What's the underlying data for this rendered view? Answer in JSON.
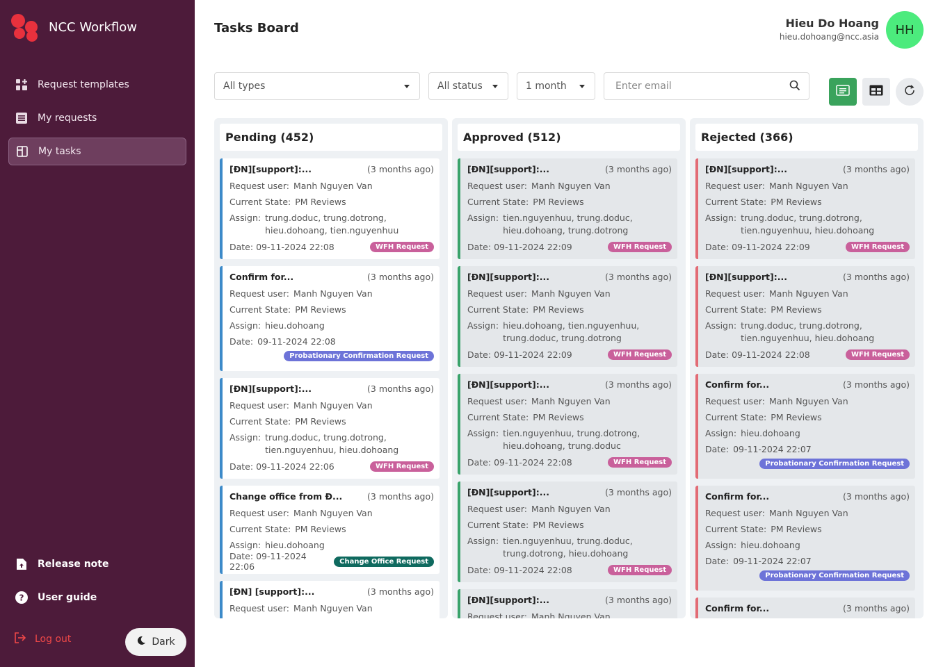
{
  "app": {
    "name": "NCC Workflow"
  },
  "sidebar": {
    "items": [
      {
        "label": "Request templates",
        "icon": "dashboard-add-icon"
      },
      {
        "label": "My requests",
        "icon": "list-icon"
      },
      {
        "label": "My tasks",
        "icon": "board-icon",
        "active": true
      }
    ],
    "bottom": [
      {
        "label": "Release note",
        "icon": "file-upload-icon"
      },
      {
        "label": "User guide",
        "icon": "help-circle-icon"
      }
    ],
    "logout": "Log out",
    "dark": "Dark"
  },
  "header": {
    "title": "Tasks Board",
    "user_name": "Hieu Do Hoang",
    "user_email": "hieu.dohoang@ncc.asia",
    "avatar": "HH"
  },
  "filters": {
    "type": "All types",
    "status": "All status",
    "period": "1 month",
    "email_placeholder": "Enter email"
  },
  "labels": {
    "request_user": "Request user:",
    "state": "Current State:",
    "assign": "Assign:",
    "date": "Date:"
  },
  "columns": [
    {
      "title": "Pending (452)",
      "cards": [
        {
          "title": "[ĐN][support]:...",
          "ago": "(3 months ago)",
          "user": "Manh Nguyen Van",
          "state": "PM Reviews",
          "assign": "trung.doduc, trung.dotrong, hieu.dohoang, tien.nguyenhuu",
          "date": "09-11-2024 22:08",
          "badge": "WFH Request"
        },
        {
          "title": "Confirm for...",
          "ago": "(3 months ago)",
          "user": "Manh Nguyen Van",
          "state": "PM Reviews",
          "assign": "hieu.dohoang",
          "date": "09-11-2024 22:08",
          "badge": "Probationary Confirmation Request"
        },
        {
          "title": "[ĐN][support]:...",
          "ago": "(3 months ago)",
          "user": "Manh Nguyen Van",
          "state": "PM Reviews",
          "assign": "trung.doduc, trung.dotrong, tien.nguyenhuu, hieu.dohoang",
          "date": "09-11-2024 22:06",
          "badge": "WFH Request"
        },
        {
          "title": "Change office from Đ...",
          "ago": "(3 months ago)",
          "user": "Manh Nguyen Van",
          "state": "PM Reviews",
          "assign": "hieu.dohoang",
          "date": "09-11-2024 22:06",
          "badge": "Change Office Request"
        },
        {
          "title": "[ĐN] [support]:...",
          "ago": "(3 months ago)",
          "user": "Manh Nguyen Van"
        }
      ]
    },
    {
      "title": "Approved (512)",
      "cards": [
        {
          "title": "[ĐN][support]:...",
          "ago": "(3 months ago)",
          "user": "Manh Nguyen Van",
          "state": "PM Reviews",
          "assign": "tien.nguyenhuu, trung.doduc, hieu.dohoang, trung.dotrong",
          "date": "09-11-2024 22:09",
          "badge": "WFH Request"
        },
        {
          "title": "[ĐN][support]:...",
          "ago": "(3 months ago)",
          "user": "Manh Nguyen Van",
          "state": "PM Reviews",
          "assign": "hieu.dohoang, tien.nguyenhuu, trung.doduc, trung.dotrong",
          "date": "09-11-2024 22:09",
          "badge": "WFH Request"
        },
        {
          "title": "[ĐN][support]:...",
          "ago": "(3 months ago)",
          "user": "Manh Nguyen Van",
          "state": "PM Reviews",
          "assign": "tien.nguyenhuu, trung.dotrong, hieu.dohoang, trung.doduc",
          "date": "09-11-2024 22:08",
          "badge": "WFH Request"
        },
        {
          "title": "[ĐN][support]:...",
          "ago": "(3 months ago)",
          "user": "Manh Nguyen Van",
          "state": "PM Reviews",
          "assign": "tien.nguyenhuu, trung.doduc, trung.dotrong, hieu.dohoang",
          "date": "09-11-2024 22:08",
          "badge": "WFH Request"
        },
        {
          "title": "[ĐN][support]:...",
          "ago": "(3 months ago)",
          "user": "Manh Nguyen Van"
        }
      ]
    },
    {
      "title": "Rejected (366)",
      "cards": [
        {
          "title": "[ĐN][support]:...",
          "ago": "(3 months ago)",
          "user": "Manh Nguyen Van",
          "state": "PM Reviews",
          "assign": "trung.doduc, trung.dotrong, tien.nguyenhuu, hieu.dohoang",
          "date": "09-11-2024 22:09",
          "badge": "WFH Request"
        },
        {
          "title": "[ĐN][support]:...",
          "ago": "(3 months ago)",
          "user": "Manh Nguyen Van",
          "state": "PM Reviews",
          "assign": "trung.doduc, trung.dotrong, tien.nguyenhuu, hieu.dohoang",
          "date": "09-11-2024 22:08",
          "badge": "WFH Request"
        },
        {
          "title": "Confirm for...",
          "ago": "(3 months ago)",
          "user": "Manh Nguyen Van",
          "state": "PM Reviews",
          "assign": "hieu.dohoang",
          "date": "09-11-2024 22:07",
          "badge": "Probationary Confirmation Request"
        },
        {
          "title": "Confirm for...",
          "ago": "(3 months ago)",
          "user": "Manh Nguyen Van",
          "state": "PM Reviews",
          "assign": "hieu.dohoang",
          "date": "09-11-2024 22:07",
          "badge": "Probationary Confirmation Request"
        },
        {
          "title": "Confirm for...",
          "ago": "(3 months ago)"
        }
      ]
    }
  ],
  "colors": {
    "sidebar": "#4d1b3a",
    "accent_green": "#3aa35c",
    "pending": "#3c8ac9",
    "approved": "#3aa36b",
    "rejected": "#e26b75"
  }
}
